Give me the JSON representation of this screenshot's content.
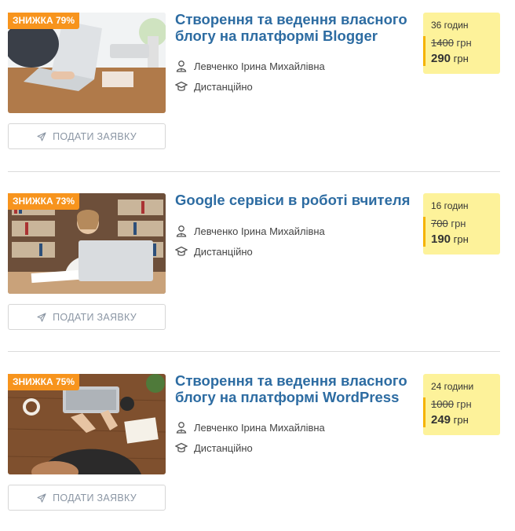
{
  "courses": [
    {
      "badge": "ЗНИЖКА 79%",
      "title": "Створення та ведення власного блогу на платформі Blogger",
      "author": "Левченко Ірина Михайлівна",
      "format": "Дистанційно",
      "hours": "36 годин",
      "old_price": "1400",
      "new_price": "290",
      "currency": "грн",
      "apply_label": "ПОДАТИ ЗАЯВКУ"
    },
    {
      "badge": "ЗНИЖКА 73%",
      "title": "Google сервіси в роботі вчителя",
      "author": "Левченко Ірина Михайлівна",
      "format": "Дистанційно",
      "hours": "16 годин",
      "old_price": "700",
      "new_price": "190",
      "currency": "грн",
      "apply_label": "ПОДАТИ ЗАЯВКУ"
    },
    {
      "badge": "ЗНИЖКА 75%",
      "title": "Створення та ведення власного блогу на платформі WordPress",
      "author": "Левченко Ірина Михайлівна",
      "format": "Дистанційно",
      "hours": "24 години",
      "old_price": "1000",
      "new_price": "249",
      "currency": "грн",
      "apply_label": "ПОДАТИ ЗАЯВКУ"
    }
  ],
  "colors": {
    "badge": "#f7941d",
    "title": "#2d6ca2",
    "price_bg": "#fdf29a",
    "price_bar": "#f5b301"
  }
}
